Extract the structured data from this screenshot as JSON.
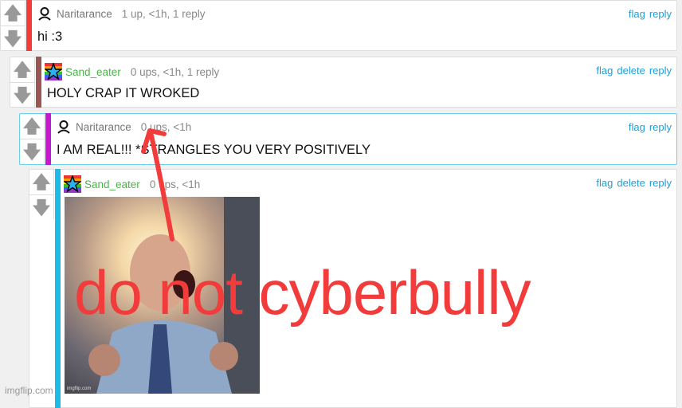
{
  "comments": [
    {
      "user": "Naritarance",
      "meta": "1 up, <1h, 1 reply",
      "text": "hi :3",
      "actions": [
        "flag",
        "reply"
      ],
      "bar_color": "#f23b3b",
      "avatar": "person-outline-icon"
    },
    {
      "user": "Sand_eater",
      "meta": "0 ups, <1h, 1 reply",
      "text": "HOLY CRAP IT WROKED",
      "actions": [
        "flag",
        "delete",
        "reply"
      ],
      "bar_color": "#9a5555",
      "avatar": "rainbow-star-icon"
    },
    {
      "user": "Naritarance",
      "meta": "0 ups, <1h",
      "text": "I AM REAL!!! *STRANGLES YOU VERY POSITIVELY",
      "actions": [
        "flag",
        "reply"
      ],
      "bar_color": "#c21ad1",
      "avatar": "person-outline-icon"
    },
    {
      "user": "Sand_eater",
      "meta": "0 ups, <1h",
      "actions": [
        "flag",
        "delete",
        "reply"
      ],
      "bar_color": "#1ebbe8",
      "avatar": "rainbow-star-icon",
      "image_watermark": "imgflip.com"
    }
  ],
  "overlay": {
    "caption": "do not cyberbully",
    "caption_color": "#f23b3b"
  },
  "site_watermark": "imgflip.com",
  "icons": {
    "upvote": "arrow-up-icon",
    "downvote": "arrow-down-icon"
  }
}
